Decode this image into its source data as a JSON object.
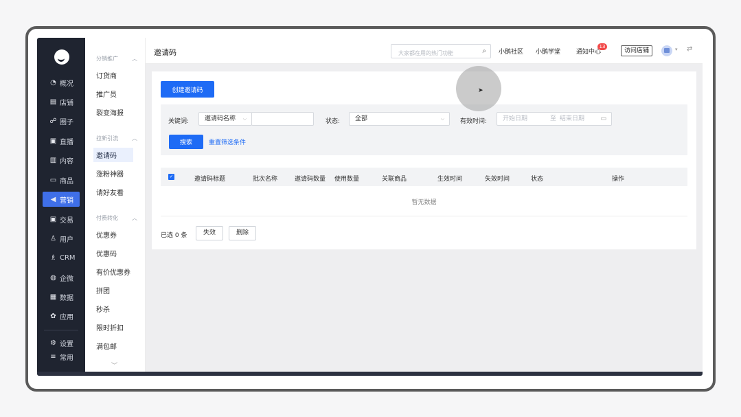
{
  "nav": [
    {
      "icon": "◔",
      "icon_name": "overview-icon",
      "label": "概况"
    },
    {
      "icon": "▤",
      "icon_name": "store-icon",
      "label": "店铺"
    },
    {
      "icon": "☍",
      "icon_name": "circle-icon",
      "label": "圈子"
    },
    {
      "icon": "▣",
      "icon_name": "live-icon",
      "label": "直播"
    },
    {
      "icon": "▥",
      "icon_name": "content-icon",
      "label": "内容"
    },
    {
      "icon": "▭",
      "icon_name": "goods-icon",
      "label": "商品"
    },
    {
      "icon": "◀",
      "icon_name": "marketing-icon",
      "label": "营销"
    },
    {
      "icon": "▣",
      "icon_name": "trade-icon",
      "label": "交易"
    },
    {
      "icon": "♙",
      "icon_name": "user-icon",
      "label": "用户"
    },
    {
      "icon": "♗",
      "icon_name": "crm-icon",
      "label": "CRM"
    },
    {
      "icon": "◍",
      "icon_name": "wecom-icon",
      "label": "企微"
    },
    {
      "icon": "▦",
      "icon_name": "data-icon",
      "label": "数据"
    },
    {
      "icon": "✿",
      "icon_name": "apps-icon",
      "label": "应用"
    }
  ],
  "nav_bottom": [
    {
      "icon": "⚙",
      "icon_name": "settings-icon",
      "label": "设置"
    },
    {
      "icon": "≡",
      "icon_name": "common-icon",
      "label": "常用"
    }
  ],
  "subnav": {
    "group1": "分销推广",
    "group1_items": [
      "订货商",
      "推广员",
      "裂变海报"
    ],
    "group2": "拉新引流",
    "group2_items": [
      "邀请码",
      "涨粉神器",
      "请好友看"
    ],
    "group3": "付费转化",
    "group3_items": [
      "优惠券",
      "优惠码",
      "有价优惠券",
      "拼团",
      "秒杀",
      "限时折扣",
      "满包邮"
    ],
    "collapse_icon": "︿",
    "more_icon": "﹀"
  },
  "header": {
    "title": "邀请码",
    "search_placeholder": "大家都在用的热门功能",
    "search_icon": "⌕",
    "links": [
      "小鹅社区",
      "小鹅学堂",
      "通知中心"
    ],
    "notice_count": "13",
    "visit_store": "访问店铺",
    "switch_icon": "⇄"
  },
  "main": {
    "create_button": "创建邀请码",
    "keyword_label": "关键词:",
    "keyword_select": "邀请码名称",
    "status_label": "状态:",
    "status_value": "全部",
    "valid_time_label": "有效时间:",
    "start_placeholder": "开始日期",
    "range_sep": "至",
    "end_placeholder": "结束日期",
    "search_button": "搜索",
    "reset_link": "重置筛选条件",
    "columns": [
      "邀请码标题",
      "批次名称",
      "邀请码数量",
      "使用数量",
      "关联商品",
      "生效时间",
      "失效时间",
      "状态",
      "操作"
    ],
    "empty_text": "暂无数据",
    "selected_text": "已选 0 条",
    "disable_button": "失效",
    "delete_button": "删除"
  },
  "colors": {
    "primary": "#1e6bf5",
    "nav_bg": "#1f2430",
    "badge": "#f24848"
  }
}
